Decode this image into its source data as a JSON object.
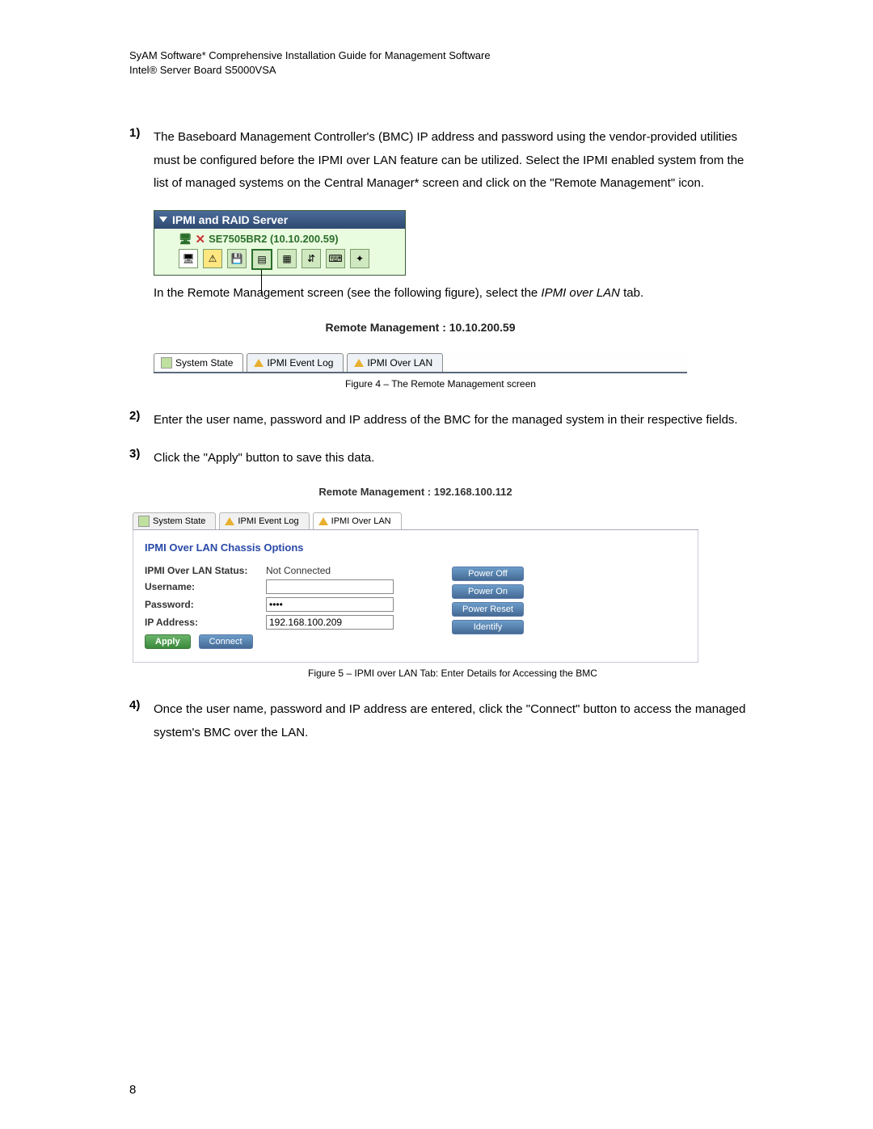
{
  "header": {
    "line1": "SyAM Software* Comprehensive Installation Guide for Management Software",
    "line2": "Intel® Server Board S5000VSA"
  },
  "steps": {
    "s1": {
      "num": "1)",
      "text1": "The Baseboard Management Controller's (BMC) IP address and password using the vendor-provided utilities must be configured before the IPMI over LAN feature can be utilized.",
      "text2": "Select the IPMI enabled system from the list of managed systems on the Central Manager* screen and click on the \"Remote Management\" icon."
    },
    "s1b": {
      "text": "In the Remote Management screen (see the following figure), select the ",
      "italic": "IPMI over LAN",
      "tail": " tab."
    },
    "s2": {
      "num": "2)",
      "text": "Enter the user name, password and IP address of the BMC for the managed system in their respective fields."
    },
    "s3": {
      "num": "3)",
      "text": "Click the \"Apply\" button to save this data."
    },
    "s4": {
      "num": "4)",
      "text": "Once the user name, password and IP address are entered, click the \"Connect\" button to access the managed system's BMC over the LAN."
    }
  },
  "fig1": {
    "title": "IPMI and RAID Server",
    "system": "SE7505BR2 (10.10.200.59)"
  },
  "fig2": {
    "title": "Remote Management : 10.10.200.59",
    "tab1": "System State",
    "tab2": "IPMI Event Log",
    "tab3": "IPMI Over LAN",
    "caption": "Figure 4 – The Remote Management screen"
  },
  "fig3": {
    "title": "Remote Management : 192.168.100.112",
    "tab1": "System State",
    "tab2": "IPMI Event Log",
    "tab3": "IPMI Over LAN",
    "heading": "IPMI Over LAN Chassis Options",
    "status_label": "IPMI Over LAN Status:",
    "status_value": "Not Connected",
    "username_label": "Username:",
    "username_value": "",
    "password_label": "Password:",
    "password_value": "••••",
    "ip_label": "IP Address:",
    "ip_value": "192.168.100.209",
    "apply": "Apply",
    "connect": "Connect",
    "power_off": "Power Off",
    "power_on": "Power On",
    "power_reset": "Power Reset",
    "identify": "Identify",
    "caption": "Figure 5 – IPMI over LAN Tab: Enter Details for Accessing the BMC"
  },
  "page_number": "8"
}
